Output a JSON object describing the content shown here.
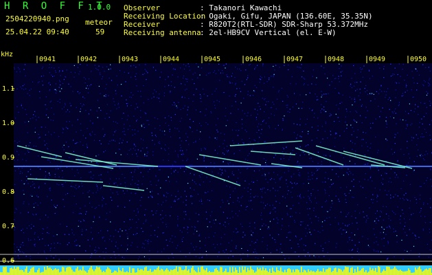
{
  "header": {
    "app_name": "H R O F F T",
    "version": "1.0.0",
    "filename": "2504220940.png",
    "datetime": "25.04.22 09:40",
    "meteor_label": "meteor",
    "meteor_count": "59",
    "info_labels": [
      "Observer",
      "Receiving Location",
      "Receiver",
      "Receiving antenna"
    ],
    "info_values": [
      ": Takanori Kawachi",
      ": Ogaki, Gifu, JAPAN (136.60E, 35.35N)",
      ": R820T2(RTL-SDR) SDR-Sharp 53.372MHz",
      ": 2el-HB9CV Vertical (el. E-W)"
    ]
  },
  "spectrogram": {
    "y_unit": "kHz",
    "y_ticks": [
      "1.1",
      "1.0",
      "0.9",
      "0.8",
      "0.7",
      "0.6"
    ],
    "x_ticks": [
      "0941",
      "0942",
      "0943",
      "0944",
      "0945",
      "0946",
      "0947",
      "0948",
      "0949",
      "0950"
    ],
    "colors": {
      "background": "#000000",
      "text": "#ffff33",
      "signal": "#2a3bff",
      "meteor": "#7fffd4",
      "bars": "#ffff00",
      "grid": "#c8c8c8"
    }
  }
}
